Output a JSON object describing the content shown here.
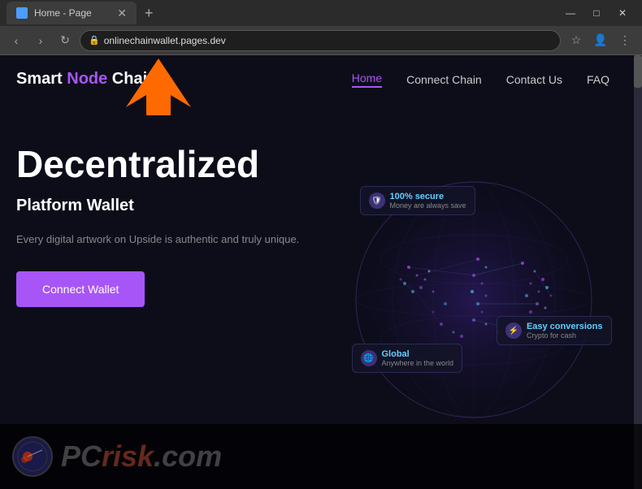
{
  "browser": {
    "tab_title": "Home - Page",
    "url": "onlinechainwallet.pages.dev",
    "new_tab_label": "+",
    "nav_back": "‹",
    "nav_forward": "›",
    "nav_refresh": "↻",
    "win_minimize": "—",
    "win_maximize": "□",
    "win_close": "✕"
  },
  "site": {
    "logo": {
      "smart": "Smart ",
      "node": "Node",
      "chain": " Chain"
    },
    "nav": {
      "home": "Home",
      "connect_chain": "Connect Chain",
      "contact_us": "Contact Us",
      "faq": "FAQ"
    },
    "hero": {
      "title": "Decentralized",
      "subtitle": "Platform Wallet",
      "description": "Every digital artwork on Upside is authentic and truly unique.",
      "cta_button": "Connect Wallet"
    },
    "features": [
      {
        "title": "100% secure",
        "subtitle": "Money are always save",
        "position": "top-left"
      },
      {
        "title": "Easy conversions",
        "subtitle": "Crypto for cash",
        "position": "mid-right"
      },
      {
        "title": "Global",
        "subtitle": "Anywhere in the world",
        "position": "bottom-left"
      }
    ],
    "watermark": {
      "text": "risk",
      "prefix": "PC",
      "suffix": ".com"
    }
  }
}
